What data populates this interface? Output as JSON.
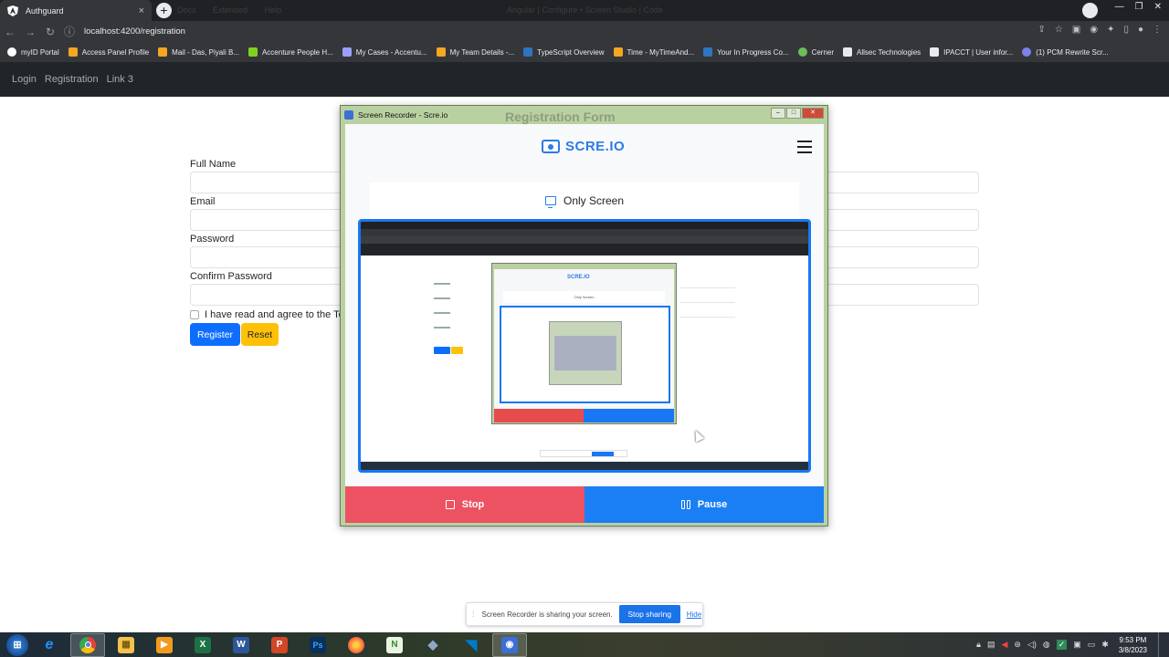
{
  "browser": {
    "tab_title": "Authguard",
    "tab_close": "×",
    "new_tab": "+",
    "ghost_tabs": [
      "Docs",
      "Extended",
      "Help"
    ],
    "ghost_title": "Angular | Configure • Screen Studio | Code",
    "url": "localhost:4200/registration",
    "bookmarks": [
      {
        "label": "myID Portal",
        "color": "#ffffff"
      },
      {
        "label": "Access Panel Profile",
        "color": "#f5a623"
      },
      {
        "label": "Mail - Das, Piyali B...",
        "color": "#f5a623"
      },
      {
        "label": "Accenture People H...",
        "color": "#7ed321"
      },
      {
        "label": "My Cases - Accentu...",
        "color": "#9aa0ff"
      },
      {
        "label": "My Team Details -...",
        "color": "#f5a623"
      },
      {
        "label": "TypeScript Overview",
        "color": "#2f74c0"
      },
      {
        "label": "Time - MyTimeAnd...",
        "color": "#f5a623"
      },
      {
        "label": "Your In Progress Co...",
        "color": "#2f74c0"
      },
      {
        "label": "Cerner",
        "color": "#6bbf59"
      },
      {
        "label": "Allsec Technologies",
        "color": "#e8eaed"
      },
      {
        "label": "IPACCT | User infor...",
        "color": "#e8eaed"
      },
      {
        "label": "(1) PCM Rewrite Scr...",
        "color": "#7b83eb"
      }
    ]
  },
  "app_nav": {
    "links": [
      "Login",
      "Registration",
      "Link 3"
    ]
  },
  "form": {
    "full_name_label": "Full Name",
    "email_label": "Email",
    "password_label": "Password",
    "confirm_password_label": "Confirm Password",
    "terms_text": "I have read and agree to the Ter",
    "register_label": "Register",
    "reset_label": "Reset"
  },
  "recorder": {
    "window_title": "Screen Recorder - Scre.io",
    "ghost_heading": "Registration Form",
    "brand": "SCRE.IO",
    "mode": "Only Screen",
    "stop_label": "Stop",
    "pause_label": "Pause",
    "preview_brand": "SCRE.IO",
    "preview_mode": "Only Screen"
  },
  "sharing": {
    "text": "Screen Recorder is sharing your screen.",
    "stop_label": "Stop sharing",
    "hide_label": "Hide"
  },
  "taskbar": {
    "apps": [
      {
        "name": "internet-explorer",
        "glyph": "e",
        "color": "#1e90ff"
      },
      {
        "name": "chrome",
        "glyph": "●",
        "color": "#e94235"
      },
      {
        "name": "file-explorer",
        "glyph": "▦",
        "color": "#f2c14e"
      },
      {
        "name": "media-player",
        "glyph": "▶",
        "color": "#f29a1f"
      },
      {
        "name": "excel",
        "glyph": "X",
        "color": "#1e7145"
      },
      {
        "name": "word",
        "glyph": "W",
        "color": "#2b579a"
      },
      {
        "name": "powerpoint",
        "glyph": "P",
        "color": "#d24726"
      },
      {
        "name": "photoshop",
        "glyph": "Ps",
        "color": "#0b2f5b"
      },
      {
        "name": "firefox",
        "glyph": "◉",
        "color": "#ff7139"
      },
      {
        "name": "notepad-plus",
        "glyph": "N",
        "color": "#7cc16a"
      },
      {
        "name": "git-tool",
        "glyph": "◆",
        "color": "#8fa8c8"
      },
      {
        "name": "vscode",
        "glyph": "◥",
        "color": "#007acc"
      },
      {
        "name": "screen-recorder",
        "glyph": "◉",
        "color": "#3b6fd6"
      }
    ],
    "time": "9:53 PM",
    "date": "3/8/2023"
  }
}
